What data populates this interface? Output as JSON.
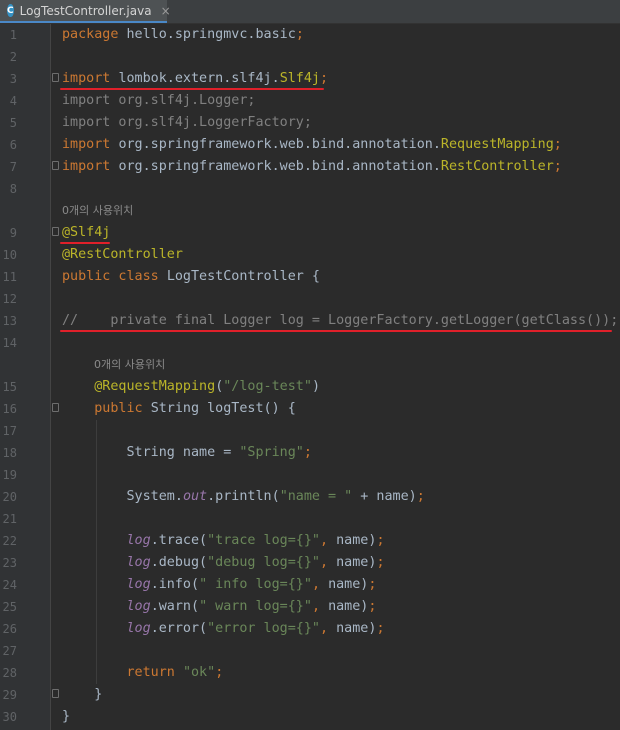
{
  "tab": {
    "icon": "C",
    "filename": "LogTestController.java",
    "close": "×"
  },
  "editor": {
    "hint_label": "0개의 사용위치",
    "lines": [
      {
        "n": "1",
        "t": [
          [
            "kw",
            "package "
          ],
          [
            "",
            "hello.springmvc.basic"
          ],
          [
            "kw",
            ";"
          ]
        ]
      },
      {
        "n": "2",
        "t": []
      },
      {
        "n": "3",
        "t": [
          [
            "kw",
            "import "
          ],
          [
            "",
            "lombok.extern.slf4j."
          ],
          [
            "ann",
            "Slf4j"
          ],
          [
            "kw",
            ";"
          ]
        ]
      },
      {
        "n": "4",
        "t": [
          [
            "unused",
            "import org.slf4j.Logger;"
          ]
        ]
      },
      {
        "n": "5",
        "t": [
          [
            "unused",
            "import org.slf4j.LoggerFactory;"
          ]
        ]
      },
      {
        "n": "6",
        "t": [
          [
            "kw",
            "import "
          ],
          [
            "",
            "org.springframework.web.bind.annotation."
          ],
          [
            "ann",
            "RequestMapping"
          ],
          [
            "kw",
            ";"
          ]
        ]
      },
      {
        "n": "7",
        "t": [
          [
            "kw",
            "import "
          ],
          [
            "",
            "org.springframework.web.bind.annotation."
          ],
          [
            "ann",
            "RestController"
          ],
          [
            "kw",
            ";"
          ]
        ]
      },
      {
        "n": "8",
        "t": []
      },
      {
        "n": "9",
        "t": [
          [
            "ann",
            "@Slf4j"
          ]
        ]
      },
      {
        "n": "10",
        "t": [
          [
            "ann",
            "@RestController"
          ]
        ]
      },
      {
        "n": "11",
        "t": [
          [
            "kw",
            "public class "
          ],
          [
            "",
            "LogTestController {"
          ]
        ]
      },
      {
        "n": "12",
        "t": []
      },
      {
        "n": "13",
        "t": [
          [
            "comment",
            "//    private final Logger log = LoggerFactory.getLogger(getClass());"
          ]
        ]
      },
      {
        "n": "14",
        "t": []
      },
      {
        "n": "15",
        "t": [
          [
            "",
            "    "
          ],
          [
            "ann",
            "@RequestMapping"
          ],
          [
            "",
            "("
          ],
          [
            "str",
            "\"/log-test\""
          ],
          [
            "",
            ")"
          ]
        ]
      },
      {
        "n": "16",
        "t": [
          [
            "",
            "    "
          ],
          [
            "kw",
            "public "
          ],
          [
            "",
            "String logTest() {"
          ]
        ]
      },
      {
        "n": "17",
        "t": []
      },
      {
        "n": "18",
        "t": [
          [
            "",
            "        String name = "
          ],
          [
            "str",
            "\"Spring\""
          ],
          [
            "kw",
            ";"
          ]
        ]
      },
      {
        "n": "19",
        "t": []
      },
      {
        "n": "20",
        "t": [
          [
            "",
            "        System."
          ],
          [
            "fld",
            "out"
          ],
          [
            "",
            ".println("
          ],
          [
            "str",
            "\"name = \""
          ],
          [
            "",
            " + name)"
          ],
          [
            "kw",
            ";"
          ]
        ]
      },
      {
        "n": "21",
        "t": []
      },
      {
        "n": "22",
        "t": [
          [
            "",
            "        "
          ],
          [
            "fld",
            "log"
          ],
          [
            "",
            ".trace("
          ],
          [
            "str",
            "\"trace log={}\""
          ],
          [
            "kw",
            ", "
          ],
          [
            "",
            "name)"
          ],
          [
            "kw",
            ";"
          ]
        ]
      },
      {
        "n": "23",
        "t": [
          [
            "",
            "        "
          ],
          [
            "fld",
            "log"
          ],
          [
            "",
            ".debug("
          ],
          [
            "str",
            "\"debug log={}\""
          ],
          [
            "kw",
            ", "
          ],
          [
            "",
            "name)"
          ],
          [
            "kw",
            ";"
          ]
        ]
      },
      {
        "n": "24",
        "t": [
          [
            "",
            "        "
          ],
          [
            "fld",
            "log"
          ],
          [
            "",
            ".info("
          ],
          [
            "str",
            "\" info log={}\""
          ],
          [
            "kw",
            ", "
          ],
          [
            "",
            "name)"
          ],
          [
            "kw",
            ";"
          ]
        ]
      },
      {
        "n": "25",
        "t": [
          [
            "",
            "        "
          ],
          [
            "fld",
            "log"
          ],
          [
            "",
            ".warn("
          ],
          [
            "str",
            "\" warn log={}\""
          ],
          [
            "kw",
            ", "
          ],
          [
            "",
            "name)"
          ],
          [
            "kw",
            ";"
          ]
        ]
      },
      {
        "n": "26",
        "t": [
          [
            "",
            "        "
          ],
          [
            "fld",
            "log"
          ],
          [
            "",
            ".error("
          ],
          [
            "str",
            "\"error log={}\""
          ],
          [
            "kw",
            ", "
          ],
          [
            "",
            "name)"
          ],
          [
            "kw",
            ";"
          ]
        ]
      },
      {
        "n": "27",
        "t": []
      },
      {
        "n": "28",
        "t": [
          [
            "",
            "        "
          ],
          [
            "kw",
            "return "
          ],
          [
            "str",
            "\"ok\""
          ],
          [
            "kw",
            ";"
          ]
        ]
      },
      {
        "n": "29",
        "t": [
          [
            "",
            "    }"
          ]
        ]
      },
      {
        "n": "30",
        "t": [
          [
            "",
            "}"
          ]
        ]
      }
    ]
  }
}
